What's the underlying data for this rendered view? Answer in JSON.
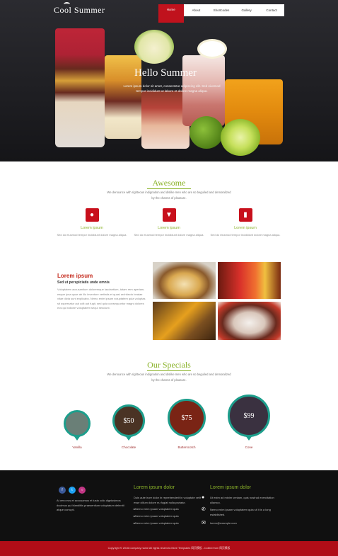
{
  "header": {
    "logo": "Cool Summer",
    "nav": [
      "Home",
      "About",
      "Shortcodes",
      "Gallery",
      "Contact"
    ],
    "active_index": 0
  },
  "hero": {
    "title": "Hello Summer",
    "text": "Lorem ipsum dolor sit amet, consectetur adipiscing elit. Sed eiusmod tempor incididunt ut labore et dolore magna aliqua."
  },
  "awesome": {
    "title": "Awesome",
    "subtitle": "We denounce with righteous indignation and dislike men who are so beguiled and demoralized by the charms of pleasure.",
    "features": [
      {
        "icon": "ice-cream-icon",
        "title": "Lorem ipsum",
        "text": "Sed do eiusmod tempor incididunt dolore magna aliqua."
      },
      {
        "icon": "cocktail-icon",
        "title": "Lorem ipsum",
        "text": "Sed do eiusmod tempor incididunt dolore magna aliqua."
      },
      {
        "icon": "popsicle-icon",
        "title": "Lorem ipsum",
        "text": "Sed do eiusmod tempor incididunt dolore magna aliqua."
      }
    ]
  },
  "about": {
    "title": "Lorem ipsum",
    "subtitle": "Sed ut perspiciatis unde omnis",
    "text": "Voluptatem accusantium doloremque laudantium, totam rem aperiam, eaque ipsa quae ab illo inventore veritatis et quasi architecto beatae vitae dicta sunt explicabo. Nemo enim ipsam voluptatem quia voluptas sit aspernatur aut odit aut fugit, sed quia consequuntur magni dolores eos qui ratione voluptatem sequi nesciunt."
  },
  "specials": {
    "title": "Our Specials",
    "subtitle": "We denounce with righteous indignation and dislike men who are so beguiled and demoralized by the charms of pleasure.",
    "items": [
      {
        "name": "Vanilla",
        "price": "",
        "color": "#6a7f77"
      },
      {
        "name": "Chocolate",
        "price": "$50",
        "color": "#4a3324"
      },
      {
        "name": "Butterscotch",
        "price": "$75",
        "color": "#7a2415"
      },
      {
        "name": "Cone",
        "price": "$99",
        "color": "#3a3140"
      }
    ]
  },
  "footer": {
    "about_text": "At vero eos et accusamus et iusto odio dignissimos ducimus qui blanditiis praesentium voluptatum deleniti atque corrupti.",
    "col1_title": "Lorem ipsum dolor",
    "col1_text": "Duis aute irure dolor in reprehenderit in voluptate velit esse cillum dolore eu fugiat nulla pariatur.",
    "col1_list": [
      "Nemo enim ipsam voluptatem quia",
      "Nemo enim ipsam voluptatem quia",
      "Nemo enim ipsam voluptatem quia"
    ],
    "col2_title": "Lorem ipsum dolor",
    "contact_address": "Ut enim ad minim veniam, quis nostrud exercitation ullamco.",
    "contact_phone": "Nemo enim ipsam voluptatem quia sit it is a long established.",
    "contact_email": "lorem@example.com",
    "copyright": "Copyright © 2016.Company name All rights reserved.More Templates 网页模板 - Collect from 网页模板"
  }
}
